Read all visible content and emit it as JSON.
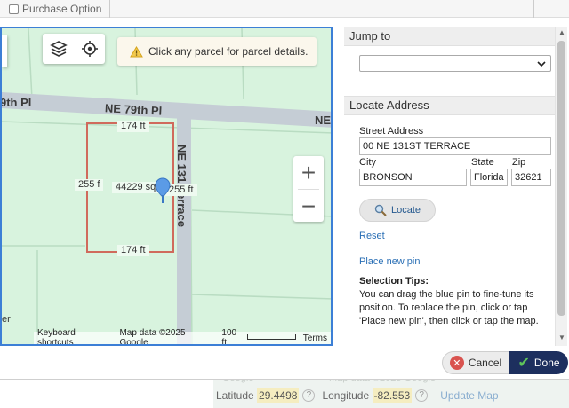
{
  "background": {
    "purchase_option": "Purchase Option",
    "latitude_label": "Latitude",
    "latitude_value": "29.4498",
    "longitude_label": "Longitude",
    "longitude_value": "-82.553",
    "update_map": "Update Map",
    "ghost_google": "Google",
    "ghost_map_data": "Map data ©2025 Google"
  },
  "map": {
    "hint": "Click any parcel for parcel details.",
    "roads": {
      "horizontal_left": "9th Pl",
      "horizontal_right": "NE 79th Pl",
      "horizontal_cut": "NE",
      "vertical": "NE 131 Terrace"
    },
    "labels": {
      "top_length": "174 ft",
      "bottom_length": "174 ft",
      "left_length": "255 f",
      "right_length": "255 ft",
      "area": "44229 sqft",
      "edge_text": "er"
    },
    "attribution": {
      "shortcuts": "Keyboard shortcuts",
      "map_data": "Map data ©2025 Google",
      "scale": "100 ft",
      "terms": "Terms"
    },
    "zoom_in": "+",
    "zoom_out": "−"
  },
  "panel": {
    "jump_to": "Jump to",
    "locate_address": "Locate Address",
    "street_label": "Street Address",
    "street_value": "00 NE 131ST TERRACE",
    "city_label": "City",
    "city_value": "BRONSON",
    "state_label": "State",
    "state_value": "Florida",
    "zip_label": "Zip",
    "zip_value": "32621",
    "locate_button": "Locate",
    "reset": "Reset",
    "place_new_pin": "Place new pin",
    "tips_title": "Selection Tips:",
    "tips_body": "You can drag the blue pin to fine-tune its position. To replace the pin, click or tap 'Place new pin', then click or tap the map."
  },
  "footer": {
    "cancel": "Cancel",
    "done": "Done"
  },
  "colors": {
    "map_bg": "#d8f3de",
    "road": "#c5cdd5",
    "parcel_outline": "#d06a5c",
    "map_border": "#3c7fd6",
    "link": "#2a6fb5",
    "done_bg": "#1d2f5e"
  }
}
